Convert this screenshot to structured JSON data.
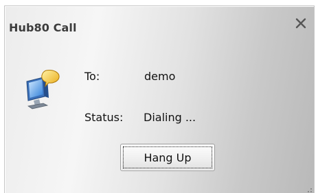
{
  "window": {
    "title": "Hub80 Call",
    "close_icon": "close-icon"
  },
  "call": {
    "to_label": "To:",
    "to_value": "demo",
    "status_label": "Status:",
    "status_value": "Dialing ..."
  },
  "actions": {
    "hangup_label": "Hang Up"
  },
  "icons": {
    "call_icon": "monitor-speech-bubble-icon",
    "resize_grip": "resize-grip-icon"
  }
}
